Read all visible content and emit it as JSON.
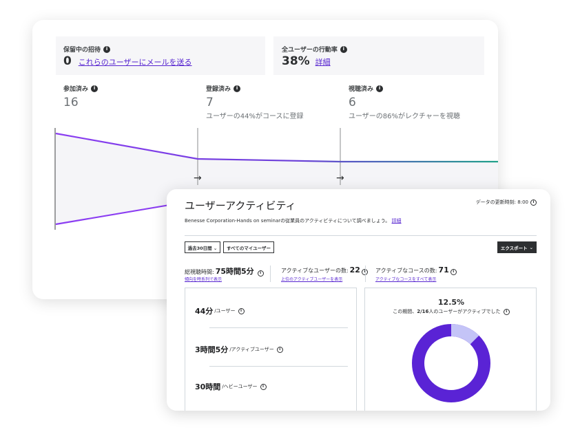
{
  "funnel": {
    "pending_invites": {
      "label": "保留中の招待",
      "count": "0",
      "link": "これらのユーザーにメールを送る"
    },
    "activity_rate": {
      "label": "全ユーザーの行動率",
      "value": "38%",
      "link": "詳細"
    },
    "stages": [
      {
        "label": "参加済み",
        "count": "16",
        "sub": ""
      },
      {
        "label": "登録済み",
        "count": "7",
        "sub": "ユーザーの44%がコースに登録"
      },
      {
        "label": "視聴済み",
        "count": "6",
        "sub": "ユーザーの86%がレクチャーを視聴"
      }
    ],
    "arrow_glyph": "→",
    "info_glyph": "i",
    "colors": {
      "line_start": "#8b3df2",
      "line_end": "#1fa189",
      "fill": "#f5f5f8"
    }
  },
  "activity": {
    "title": "ユーザーアクティビティ",
    "updated": "データの更新時刻: 8:00",
    "description": "Benesse Corporation-Hands on seminarの従業員のアクティビティについて調べましょう。",
    "description_link": "詳細",
    "filters": {
      "period": "過去30日間 ⌄",
      "users": "すべてのマイユーザー"
    },
    "export_label": "エクスポート",
    "export_chevron": "⌄",
    "metrics": [
      {
        "label": "総視聴時間:",
        "value": "75時間5分",
        "link": "傾向を時系列で表示"
      },
      {
        "label": "アクティブなユーザーの数:",
        "value": "22",
        "link": "上位のアクティブユーザーを表示"
      },
      {
        "label": "アクティブなコースの数:",
        "value": "71",
        "link": "アクティブなコースをすべて表示"
      }
    ],
    "usage": [
      {
        "value": "44分",
        "unit": "/ユーザー"
      },
      {
        "value": "3時間5分",
        "unit": "/アクティブユーザー"
      },
      {
        "value": "30時間",
        "unit": "/ヘビーユーザー"
      }
    ],
    "donut": {
      "percent": "12.5%",
      "caption_prefix": "この期間、",
      "caption_bold": "2/16",
      "caption_suffix": "人のユーザーがアクティブでした",
      "active_fraction": 0.125,
      "colors": {
        "active": "#c4c4f7",
        "inactive": "#5a23d5"
      }
    }
  }
}
